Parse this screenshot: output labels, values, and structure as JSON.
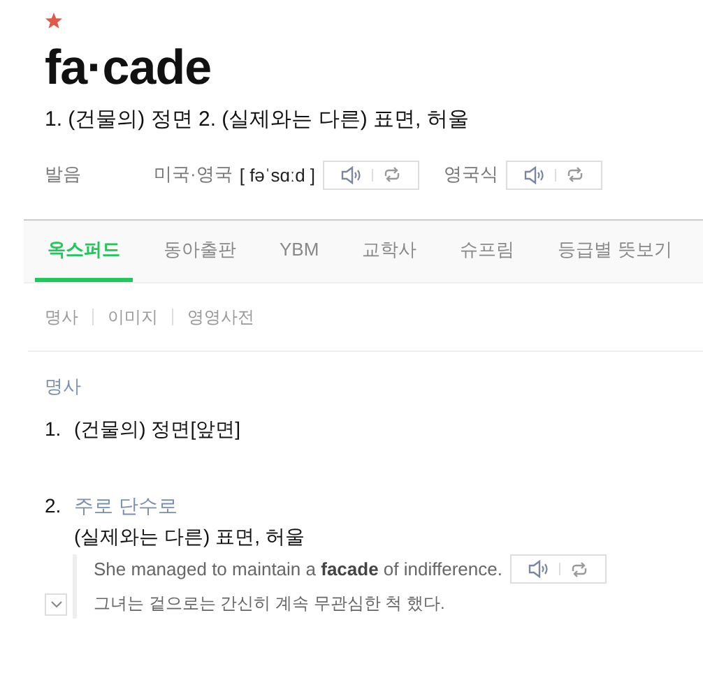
{
  "headword": "fa·cade",
  "summary": "1. (건물의) 정면 2. (실제와는 다른) 표면, 허울",
  "pronunciation": {
    "label": "발음",
    "entries": [
      {
        "region": "미국·영국",
        "ipa": "[ fəˈsɑːd ]"
      },
      {
        "region": "영국식"
      }
    ]
  },
  "tabs": [
    {
      "label": "옥스퍼드",
      "selected": true
    },
    {
      "label": "동아출판",
      "selected": false
    },
    {
      "label": "YBM",
      "selected": false
    },
    {
      "label": "교학사",
      "selected": false
    },
    {
      "label": "슈프림",
      "selected": false
    },
    {
      "label": "등급별 뜻보기",
      "selected": false
    }
  ],
  "subtabs": [
    "명사",
    "이미지",
    "영영사전"
  ],
  "section": {
    "part_of_speech": "명사",
    "senses": [
      {
        "number": "1.",
        "text": "(건물의) 정면[앞면]"
      },
      {
        "number": "2.",
        "label": "주로 단수로",
        "text": "(실제와는 다른) 표면, 허울",
        "examples": [
          {
            "english": "She managed to maintain a **facade** of indifference.",
            "korean": "그녀는 겉으로는 간신히 계속 무관심한 척 했다.",
            "expanded": false
          }
        ]
      }
    ]
  }
}
